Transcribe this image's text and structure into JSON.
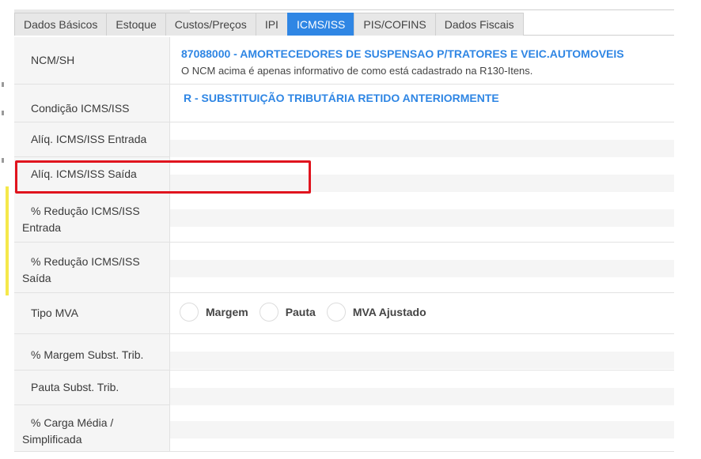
{
  "tabs": [
    {
      "label": "Dados Básicos",
      "active": false
    },
    {
      "label": "Estoque",
      "active": false
    },
    {
      "label": "Custos/Preços",
      "active": false
    },
    {
      "label": "IPI",
      "active": false
    },
    {
      "label": "ICMS/ISS",
      "active": true
    },
    {
      "label": "PIS/COFINS",
      "active": false
    },
    {
      "label": "Dados Fiscais",
      "active": false
    }
  ],
  "form": {
    "ncm": {
      "label": "NCM/SH",
      "code": "87088000 - AMORTECEDORES DE SUSPENSAO P/TRATORES E VEIC.AUTOMOVEIS",
      "note": "O NCM acima é apenas informativo de como está cadastrado na R130-Itens."
    },
    "condicao": {
      "label": "Condição ICMS/ISS",
      "value": "R - SUBSTITUIÇÃO TRIBUTÁRIA RETIDO ANTERIORMENTE"
    },
    "aliq_entrada": {
      "label": "Alíq. ICMS/ISS Entrada",
      "value": ""
    },
    "aliq_saida": {
      "label": "Alíq. ICMS/ISS Saída",
      "value": ""
    },
    "reducao_entrada": {
      "label": "% Redução ICMS/ISS Entrada",
      "value": ""
    },
    "reducao_saida": {
      "label": "% Redução ICMS/ISS Saída",
      "value": ""
    },
    "tipo_mva": {
      "label": "Tipo MVA",
      "options": [
        "Margem",
        "Pauta",
        "MVA Ajustado"
      ],
      "selected": null
    },
    "margem_st": {
      "label": "% Margem Subst. Trib.",
      "value": ""
    },
    "pauta_st": {
      "label": "Pauta Subst. Trib.",
      "value": ""
    },
    "carga_media": {
      "label": "% Carga Média / Simplificada",
      "value": ""
    }
  },
  "colors": {
    "accent": "#2f86e4",
    "highlight": "#e0141e"
  }
}
